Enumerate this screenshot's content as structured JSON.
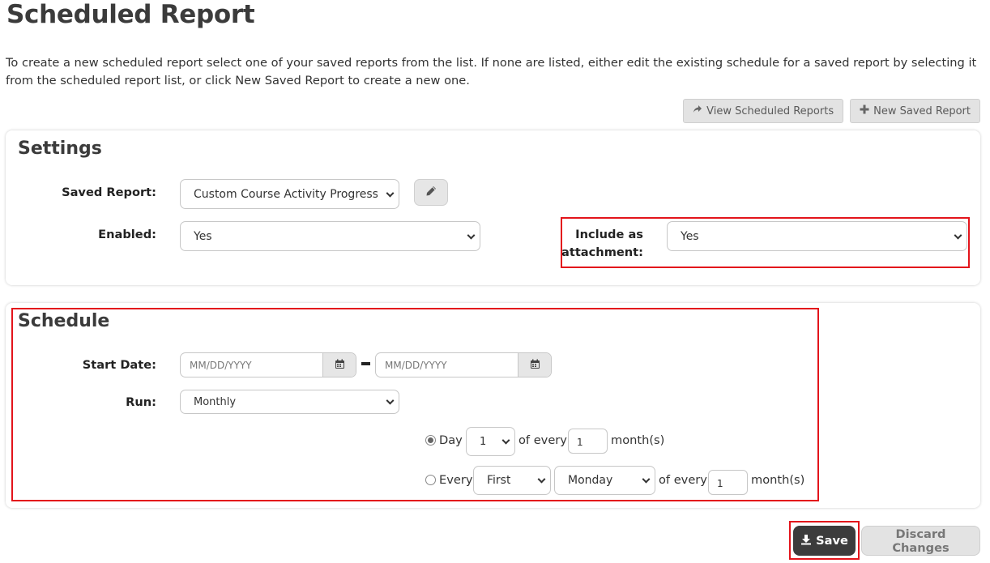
{
  "page": {
    "title": "Scheduled Report",
    "intro": "To create a new scheduled report select one of your saved reports from the list. If none are listed, either edit the existing schedule for a saved report by selecting it from the scheduled report list, or click New Saved Report to create a new one."
  },
  "top_actions": {
    "view_scheduled": "View Scheduled Reports",
    "new_saved": "New Saved Report"
  },
  "settings": {
    "title": "Settings",
    "saved_report_label": "Saved Report:",
    "saved_report_value": "Custom Course Activity Progress Report",
    "enabled_label": "Enabled:",
    "enabled_value": "Yes",
    "attachment_label_1": "Include as",
    "attachment_label_2": "attachment:",
    "attachment_value": "Yes"
  },
  "schedule": {
    "title": "Schedule",
    "start_date_label": "Start Date:",
    "start_placeholder": "MM/DD/YYYY",
    "end_placeholder": "MM/DD/YYYY",
    "run_label": "Run:",
    "run_value": "Monthly",
    "option_day": {
      "selected": true,
      "label": "Day",
      "day_value": "1",
      "of_every": "of every",
      "interval": "1",
      "unit": "month(s)"
    },
    "option_every": {
      "selected": false,
      "label": "Every",
      "ordinal_value": "First",
      "weekday_value": "Monday",
      "of_every": "of every",
      "interval": "1",
      "unit": "month(s)"
    }
  },
  "footer": {
    "save": "Save",
    "discard": "Discard Changes"
  },
  "colors": {
    "highlight": "#e3141b",
    "save_bg": "#3c3c3c",
    "light_btn_bg": "#e3e3e3"
  }
}
